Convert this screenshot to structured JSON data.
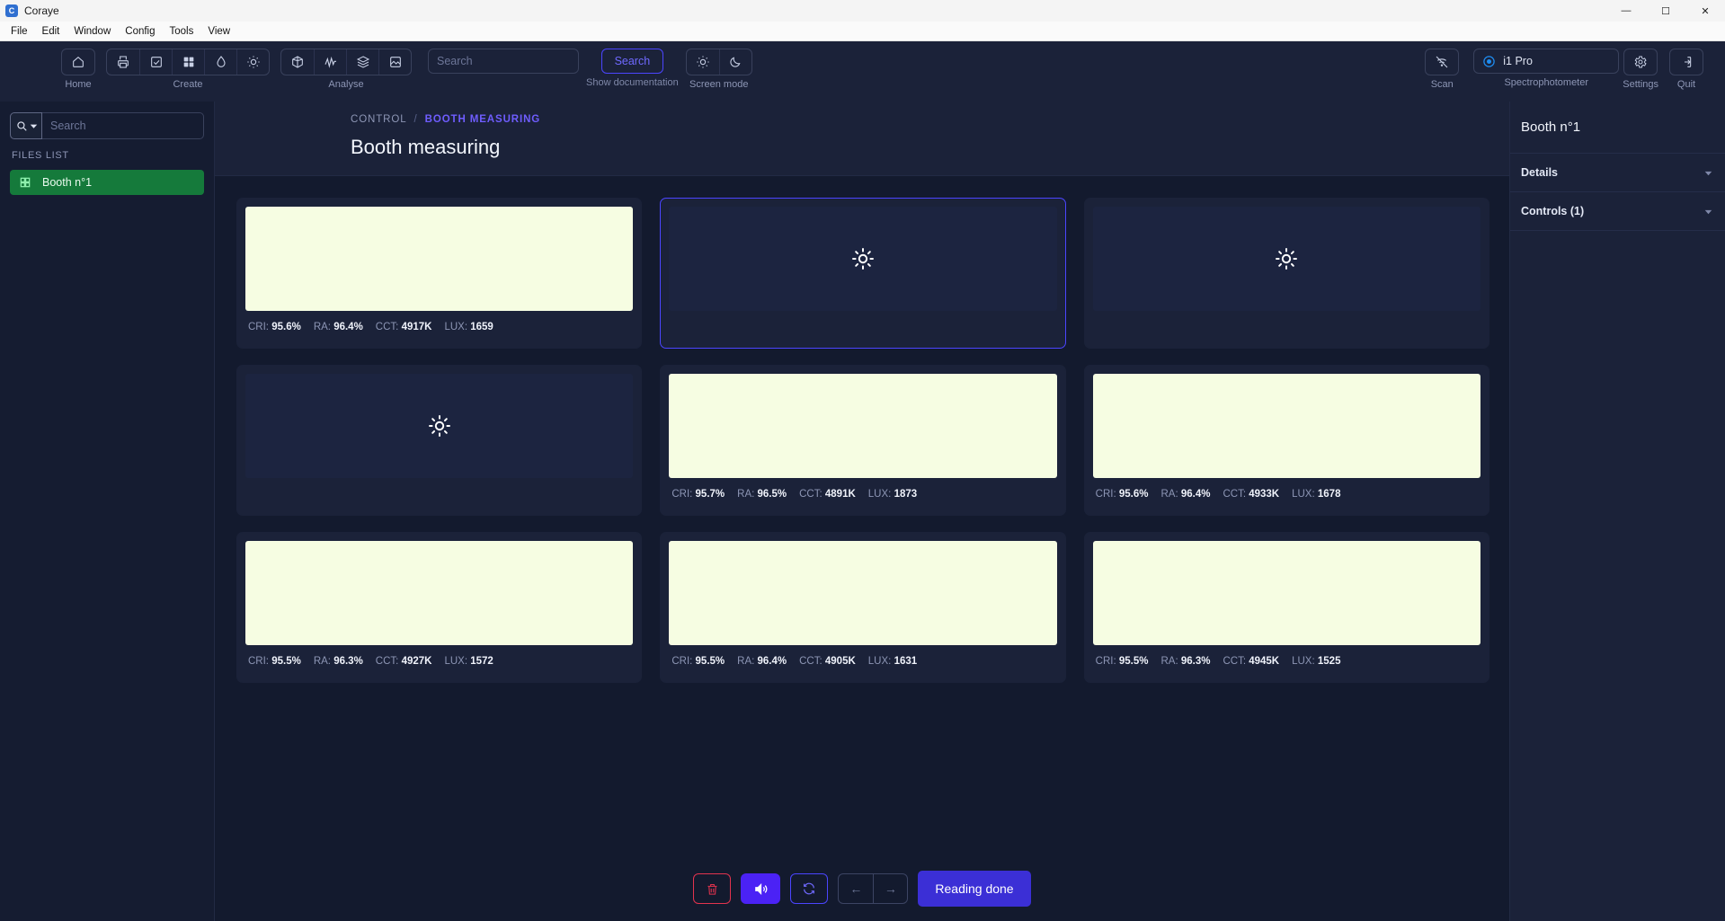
{
  "window": {
    "app_title": "Coraye",
    "logo_icon": "coraye-logo-icon",
    "minimize_icon": "minimize-icon",
    "maximize_icon": "maximize-icon",
    "close_icon": "close-icon",
    "minimize_glyph": "—",
    "maximize_glyph": "☐",
    "close_glyph": "✕"
  },
  "menubar": {
    "items": [
      {
        "label": "File"
      },
      {
        "label": "Edit"
      },
      {
        "label": "Window"
      },
      {
        "label": "Config"
      },
      {
        "label": "Tools"
      },
      {
        "label": "View"
      }
    ]
  },
  "toolbar": {
    "groups": [
      {
        "label": "Home",
        "icons": [
          "home-icon"
        ]
      },
      {
        "label": "Create",
        "icons": [
          "print-icon",
          "checkbox-icon",
          "grid-icon",
          "droplet-icon",
          "sun-icon"
        ]
      },
      {
        "label": "Analyse",
        "icons": [
          "cube-icon",
          "waveform-icon",
          "layers-icon",
          "image-icon"
        ]
      }
    ],
    "search": {
      "placeholder": "Search",
      "value": "",
      "button_label": "Search",
      "caption": "Show documentation"
    },
    "screen_mode": {
      "label": "Screen mode",
      "icons": [
        "sun-icon",
        "moon-icon"
      ]
    },
    "scan": {
      "label": "Scan",
      "icon": "wifi-off-icon"
    },
    "spectrophotometer": {
      "label": "Spectrophotometer",
      "selected": "i1 Pro",
      "status_icon": "radio-target-icon",
      "status_color": "#1e8cf0"
    },
    "settings": {
      "label": "Settings",
      "icon": "gear-icon"
    },
    "quit": {
      "label": "Quit",
      "icon": "exit-icon"
    }
  },
  "sidebar": {
    "search": {
      "placeholder": "Search",
      "value": "",
      "icon": "search-icon",
      "dropdown_icon": "caret-down-icon"
    },
    "files_list_title": "FILES LIST",
    "items": [
      {
        "label": "Booth n°1",
        "icon": "grid-icon",
        "active": true,
        "color": "#157a3b"
      }
    ]
  },
  "main": {
    "breadcrumb": {
      "root": "CONTROL",
      "separator": "/",
      "current": "BOOTH MEASURING"
    },
    "page_title": "Booth measuring",
    "accent_color": "#4b45ff",
    "swatch_color": "#f6fde2",
    "cards": [
      {
        "state": "measured",
        "swatch_color": "#f6fde2",
        "stats": [
          {
            "label": "CRI:",
            "value": "95.6%"
          },
          {
            "label": "RA:",
            "value": "96.4%"
          },
          {
            "label": "CCT:",
            "value": "4917K"
          },
          {
            "label": "LUX:",
            "value": "1659"
          }
        ]
      },
      {
        "state": "empty",
        "selected": true,
        "icon": "sun-icon",
        "stats": []
      },
      {
        "state": "empty",
        "selected": false,
        "icon": "sun-icon",
        "stats": []
      },
      {
        "state": "empty",
        "selected": false,
        "icon": "sun-icon",
        "stats": []
      },
      {
        "state": "measured",
        "swatch_color": "#f6fde2",
        "stats": [
          {
            "label": "CRI:",
            "value": "95.7%"
          },
          {
            "label": "RA:",
            "value": "96.5%"
          },
          {
            "label": "CCT:",
            "value": "4891K"
          },
          {
            "label": "LUX:",
            "value": "1873"
          }
        ]
      },
      {
        "state": "measured",
        "swatch_color": "#f6fde2",
        "stats": [
          {
            "label": "CRI:",
            "value": "95.6%"
          },
          {
            "label": "RA:",
            "value": "96.4%"
          },
          {
            "label": "CCT:",
            "value": "4933K"
          },
          {
            "label": "LUX:",
            "value": "1678"
          }
        ]
      },
      {
        "state": "measured",
        "swatch_color": "#f6fde2",
        "stats": [
          {
            "label": "CRI:",
            "value": "95.5%"
          },
          {
            "label": "RA:",
            "value": "96.3%"
          },
          {
            "label": "CCT:",
            "value": "4927K"
          },
          {
            "label": "LUX:",
            "value": "1572"
          }
        ]
      },
      {
        "state": "measured",
        "swatch_color": "#f6fde2",
        "stats": [
          {
            "label": "CRI:",
            "value": "95.5%"
          },
          {
            "label": "RA:",
            "value": "96.4%"
          },
          {
            "label": "CCT:",
            "value": "4905K"
          },
          {
            "label": "LUX:",
            "value": "1631"
          }
        ]
      },
      {
        "state": "measured",
        "swatch_color": "#f6fde2",
        "stats": [
          {
            "label": "CRI:",
            "value": "95.5%"
          },
          {
            "label": "RA:",
            "value": "96.3%"
          },
          {
            "label": "CCT:",
            "value": "4945K"
          },
          {
            "label": "LUX:",
            "value": "1525"
          }
        ]
      }
    ]
  },
  "action_bar": {
    "delete": {
      "icon": "trash-icon",
      "color": "#e2334e"
    },
    "sound": {
      "icon": "speaker-icon",
      "color": "#4b22f5"
    },
    "refresh": {
      "icon": "refresh-icon",
      "color": "#4b45ff"
    },
    "prev": {
      "icon": "arrow-left-icon",
      "glyph": "←"
    },
    "next": {
      "icon": "arrow-right-icon",
      "glyph": "→"
    },
    "done_label": "Reading done"
  },
  "right_panel": {
    "title": "Booth n°1",
    "sections": [
      {
        "label": "Details",
        "chevron": "chevron-down-icon"
      },
      {
        "label": "Controls (1)",
        "chevron": "chevron-down-icon"
      }
    ]
  }
}
